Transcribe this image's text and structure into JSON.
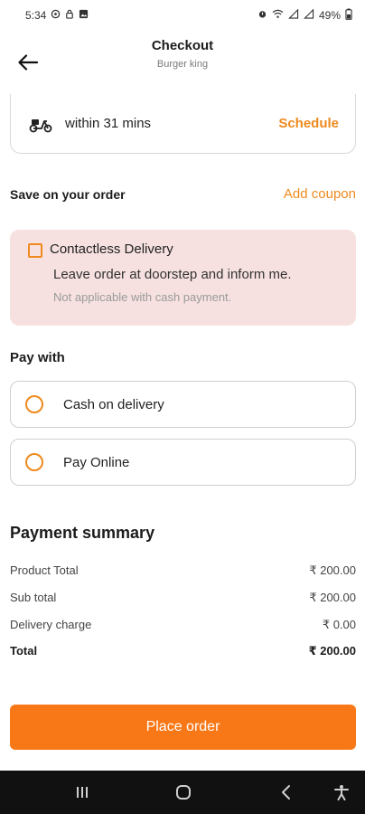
{
  "status_bar": {
    "time": "5:34",
    "battery": "49%",
    "left_icons": [
      "whatsapp-icon",
      "lock-icon",
      "gallery-icon"
    ],
    "right_icons": [
      "alarm-icon",
      "wifi-icon",
      "signal-icon",
      "signal-icon"
    ]
  },
  "header": {
    "title": "Checkout",
    "subtitle": "Burger king",
    "back_icon": "arrow-left-icon"
  },
  "delivery": {
    "time_text": "within 31 mins",
    "schedule_label": "Schedule",
    "icon": "scooter-icon"
  },
  "savings": {
    "title": "Save on your order",
    "coupon_label": "Add coupon"
  },
  "contactless": {
    "checked": false,
    "title": "Contactless Delivery",
    "description": "Leave order at doorstep and inform me.",
    "note": "Not applicable with cash payment."
  },
  "payment": {
    "title": "Pay with",
    "options": [
      {
        "label": "Cash on delivery",
        "selected": false
      },
      {
        "label": "Pay Online",
        "selected": false
      }
    ]
  },
  "summary": {
    "title": "Payment summary",
    "rows": [
      {
        "label": "Product Total",
        "value": "₹ 200.00"
      },
      {
        "label": "Sub total",
        "value": "₹ 200.00"
      },
      {
        "label": "Delivery charge",
        "value": "₹ 0.00"
      },
      {
        "label": "Total",
        "value": "₹ 200.00"
      }
    ]
  },
  "place_order_label": "Place order",
  "colors": {
    "accent": "#ee8a1e",
    "button": "#f87817",
    "contactless_bg": "#f6e1e0"
  },
  "nav_bar": [
    "recents-icon",
    "home-icon",
    "back-icon",
    "accessibility-icon"
  ]
}
